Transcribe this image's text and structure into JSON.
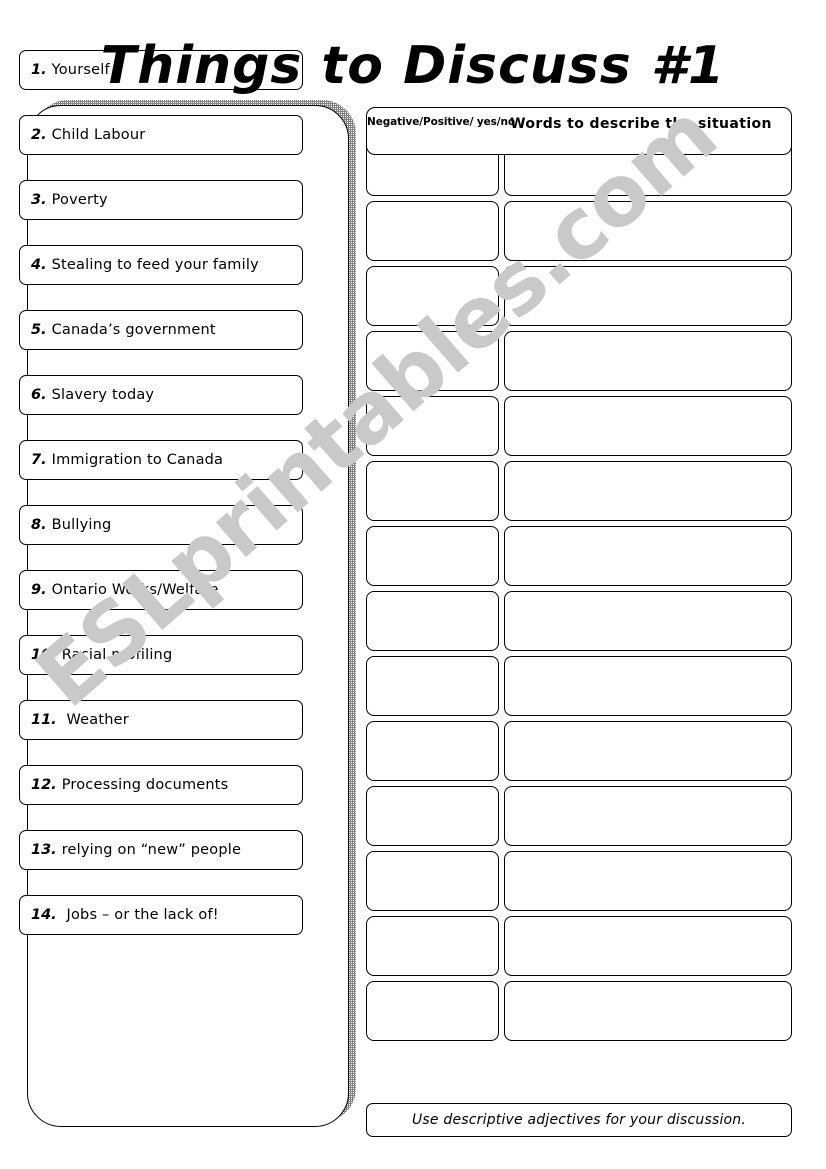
{
  "title": "Things to Discuss #1",
  "watermark": "ESLprintables.com",
  "colors": {
    "ink": "#000000",
    "paper": "#ffffff",
    "watermark": "#c9c9c9",
    "shadow": "#808080"
  },
  "topics": [
    {
      "num": "1.",
      "label": "Yourself"
    },
    {
      "num": "2.",
      "label": "Child Labour"
    },
    {
      "num": "3.",
      "label": "Poverty"
    },
    {
      "num": "4.",
      "label": "Stealing to feed your family"
    },
    {
      "num": "5.",
      "label": "Canada’s government"
    },
    {
      "num": "6.",
      "label": "Slavery today"
    },
    {
      "num": "7.",
      "label": "Immigration to Canada"
    },
    {
      "num": "8.",
      "label": "Bullying"
    },
    {
      "num": "9.",
      "label": "Ontario Works/Welfare"
    },
    {
      "num": "10.",
      "label": "Racial profiling"
    },
    {
      "num": "11.",
      "label": " Weather"
    },
    {
      "num": "12.",
      "label": "Processing documents"
    },
    {
      "num": "13.",
      "label": "relying on “new” people"
    },
    {
      "num": "14.",
      "label": " Jobs – or the lack of!"
    }
  ],
  "answer_table": {
    "header": {
      "judgement": "Negative/Positive/ yes/no",
      "words": "Words to describe the situation"
    },
    "row_count": 14,
    "rows": [
      {
        "judgement": "",
        "words": ""
      },
      {
        "judgement": "",
        "words": ""
      },
      {
        "judgement": "",
        "words": ""
      },
      {
        "judgement": "",
        "words": ""
      },
      {
        "judgement": "",
        "words": ""
      },
      {
        "judgement": "",
        "words": ""
      },
      {
        "judgement": "",
        "words": ""
      },
      {
        "judgement": "",
        "words": ""
      },
      {
        "judgement": "",
        "words": ""
      },
      {
        "judgement": "",
        "words": ""
      },
      {
        "judgement": "",
        "words": ""
      },
      {
        "judgement": "",
        "words": ""
      },
      {
        "judgement": "",
        "words": ""
      },
      {
        "judgement": "",
        "words": ""
      }
    ]
  },
  "footer_note": "Use descriptive adjectives for your discussion."
}
